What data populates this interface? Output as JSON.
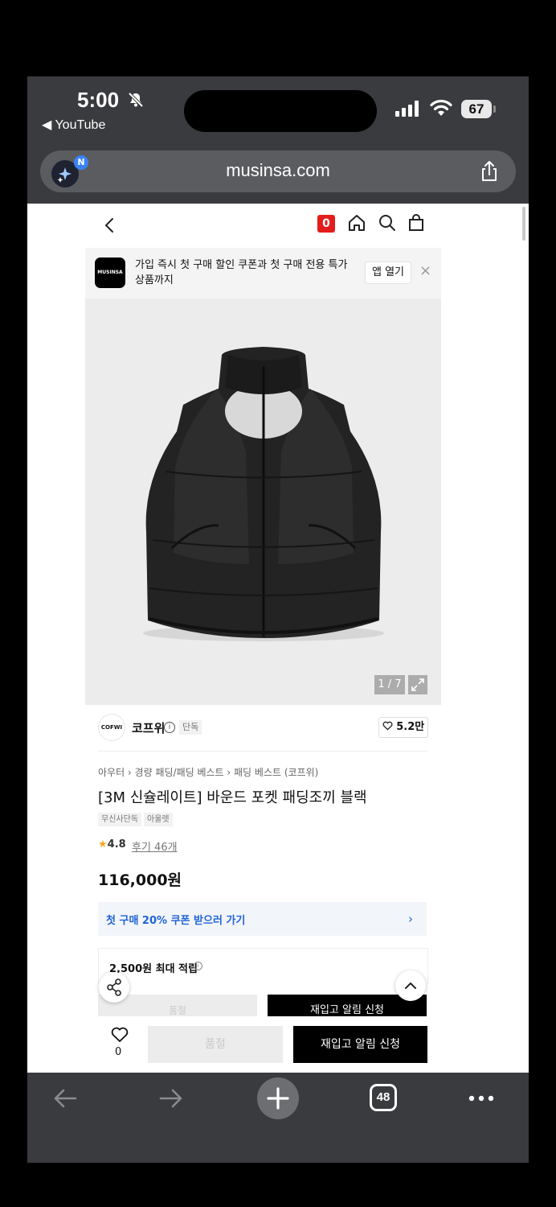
{
  "status": {
    "time": "5:00",
    "back_app": "◀ YouTube",
    "battery": "67"
  },
  "browser": {
    "url": "musinsa.com",
    "ai_badge": "N",
    "tab_count": "48"
  },
  "header": {
    "cart_count": "0"
  },
  "banner": {
    "logo": "MUSINSA",
    "text": "가입 즉시 첫 구매 할인 쿠폰과 첫 구매 전용 특가 상품까지",
    "button": "앱 열기",
    "close": "×"
  },
  "gallery": {
    "counter": "1 / 7"
  },
  "brand": {
    "logo": "COFWI",
    "name": "코프위",
    "info": "i",
    "tag": "단독",
    "likes": "5.2만"
  },
  "product": {
    "breadcrumb": "아우터 › 경량 패딩/패딩 베스트 › 패딩 베스트 (코프위)",
    "title": "[3M 신슐레이트] 바운드 포켓 패딩조끼 블랙",
    "tags": [
      "무신사단독",
      "아울렛"
    ],
    "rating": "4.8",
    "reviews": "후기 46개",
    "price": "116,000원"
  },
  "coupon": {
    "text": "첫 구매 20% 쿠폰 받으러 가기",
    "chevron": "›"
  },
  "points": {
    "text": "2,500원 최대 적립",
    "info": "i"
  },
  "purchase": {
    "wish_count": "0",
    "soldout": "품절",
    "notify": "재입고 알림 신청"
  },
  "colors": {
    "accent_red": "#e31d1c",
    "coupon_blue": "#1e63d6",
    "browser_chrome": "#3a3b3e"
  }
}
